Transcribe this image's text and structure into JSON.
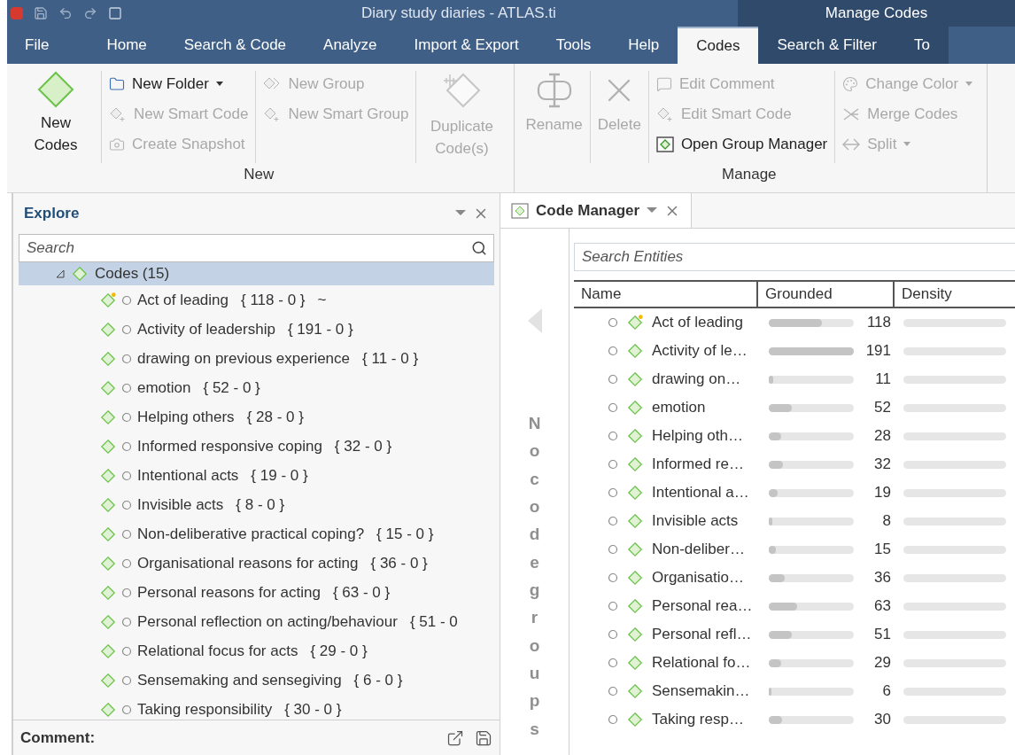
{
  "window": {
    "title": "Diary study diaries - ATLAS.ti",
    "context_title": "Manage Codes"
  },
  "tabs": [
    {
      "label": "File",
      "selected": false
    },
    {
      "label": "Home",
      "selected": false
    },
    {
      "label": "Search & Code",
      "selected": false
    },
    {
      "label": "Analyze",
      "selected": false
    },
    {
      "label": "Import & Export",
      "selected": false
    },
    {
      "label": "Tools",
      "selected": false
    },
    {
      "label": "Help",
      "selected": false
    },
    {
      "label": "Codes",
      "selected": true
    },
    {
      "label": "Search & Filter",
      "selected": false
    },
    {
      "label": "To",
      "selected": false
    }
  ],
  "ribbon": {
    "groups": [
      {
        "label": "New",
        "columns": [
          {
            "kind": "large",
            "items": [
              {
                "label": "New Codes",
                "kind": "diamond",
                "disabled": false
              }
            ]
          },
          {
            "kind": "small",
            "items": [
              {
                "label": "New Folder",
                "kind": "folder",
                "disabled": false,
                "dropdown": true
              },
              {
                "label": "New Smart Code",
                "kind": "smart",
                "disabled": true,
                "dropdown": false
              },
              {
                "label": "Create Snapshot",
                "kind": "camera",
                "disabled": true,
                "dropdown": false
              }
            ]
          },
          {
            "kind": "small",
            "items": [
              {
                "label": "New Group",
                "kind": "group",
                "disabled": true,
                "dropdown": false
              },
              {
                "label": "New Smart Group",
                "kind": "smart",
                "disabled": true,
                "dropdown": false
              }
            ]
          },
          {
            "kind": "large",
            "items": [
              {
                "label": "Duplicate Code(s)",
                "kind": "duplicate",
                "disabled": true
              }
            ]
          }
        ]
      },
      {
        "label": "Manage",
        "columns": [
          {
            "kind": "large",
            "items": [
              {
                "label": "Rename",
                "kind": "rename",
                "disabled": true
              }
            ]
          },
          {
            "kind": "large",
            "items": [
              {
                "label": "Delete",
                "kind": "delete",
                "disabled": true
              }
            ]
          },
          {
            "kind": "small",
            "items": [
              {
                "label": "Edit Comment",
                "kind": "comment",
                "disabled": true,
                "dropdown": false
              },
              {
                "label": "Edit Smart Code",
                "kind": "smart",
                "disabled": true,
                "dropdown": false
              },
              {
                "label": "Open Group Manager",
                "kind": "manager",
                "disabled": false,
                "dropdown": false
              }
            ]
          },
          {
            "kind": "small",
            "items": [
              {
                "label": "Change Color",
                "kind": "palette",
                "disabled": true,
                "dropdown": true
              },
              {
                "label": "Merge Codes",
                "kind": "merge",
                "disabled": true,
                "dropdown": false
              },
              {
                "label": "Split",
                "kind": "split",
                "disabled": true,
                "dropdown": true
              }
            ]
          }
        ]
      }
    ]
  },
  "explore": {
    "title": "Explore",
    "search": {
      "placeholder": "Search"
    },
    "tree": {
      "label": "Codes (15)",
      "expanded": true,
      "selected": true,
      "children": [
        {
          "label": "Act of leading",
          "counts": "{ 118 - 0 }",
          "suffix": "~",
          "has_comment": true
        },
        {
          "label": "Activity of leadership",
          "counts": "{ 191 - 0 }",
          "has_comment": false
        },
        {
          "label": "drawing on previous experience",
          "counts": "{ 11 - 0 }",
          "has_comment": false
        },
        {
          "label": "emotion",
          "counts": "{ 52 - 0 }",
          "has_comment": false
        },
        {
          "label": "Helping others",
          "counts": "{ 28 - 0 }",
          "has_comment": false
        },
        {
          "label": "Informed responsive coping",
          "counts": "{ 32 - 0 }",
          "has_comment": false
        },
        {
          "label": "Intentional acts",
          "counts": "{ 19 - 0 }",
          "has_comment": false
        },
        {
          "label": "Invisible acts",
          "counts": "{ 8 - 0 }",
          "has_comment": false
        },
        {
          "label": "Non-deliberative practical coping?",
          "counts": "{ 15 - 0 }",
          "has_comment": false
        },
        {
          "label": "Organisational reasons for acting",
          "counts": "{ 36 - 0 }",
          "has_comment": false
        },
        {
          "label": "Personal reasons for acting",
          "counts": "{ 63 - 0 }",
          "has_comment": false
        },
        {
          "label": "Personal reflection on acting/behaviour",
          "counts": "{ 51 - 0",
          "has_comment": false
        },
        {
          "label": "Relational focus for acts",
          "counts": "{ 29 - 0 }",
          "has_comment": false
        },
        {
          "label": "Sensemaking and sensegiving",
          "counts": "{ 6 - 0 }",
          "has_comment": false
        },
        {
          "label": "Taking responsibility",
          "counts": "{ 30 - 0 }",
          "has_comment": false
        }
      ]
    },
    "comment_label": "Comment:"
  },
  "code_manager": {
    "title": "Code Manager",
    "groups_placeholder": "No code groups",
    "search": {
      "placeholder": "Search Entities"
    },
    "columns": [
      "Name",
      "Grounded",
      "Density"
    ],
    "rows": [
      {
        "name": "Act of leading",
        "has_comment": true,
        "grounded": "118",
        "level": 0.62
      },
      {
        "name": "Activity of le…",
        "has_comment": false,
        "grounded": "191",
        "level": 1
      },
      {
        "name": "drawing on…",
        "has_comment": false,
        "grounded": "11",
        "level": 0.05
      },
      {
        "name": "emotion",
        "has_comment": false,
        "grounded": "52",
        "level": 0.27
      },
      {
        "name": "Helping oth…",
        "has_comment": false,
        "grounded": "28",
        "level": 0.15
      },
      {
        "name": "Informed re…",
        "has_comment": false,
        "grounded": "32",
        "level": 0.17
      },
      {
        "name": "Intentional a…",
        "has_comment": false,
        "grounded": "19",
        "level": 0.1
      },
      {
        "name": "Invisible acts",
        "has_comment": false,
        "grounded": "8",
        "level": 0.04
      },
      {
        "name": "Non-deliber…",
        "has_comment": false,
        "grounded": "15",
        "level": 0.08
      },
      {
        "name": "Organisatio…",
        "has_comment": false,
        "grounded": "36",
        "level": 0.19
      },
      {
        "name": "Personal rea…",
        "has_comment": false,
        "grounded": "63",
        "level": 0.33
      },
      {
        "name": "Personal refl…",
        "has_comment": false,
        "grounded": "51",
        "level": 0.27
      },
      {
        "name": "Relational fo…",
        "has_comment": false,
        "grounded": "29",
        "level": 0.15
      },
      {
        "name": "Sensemakin…",
        "has_comment": false,
        "grounded": "6",
        "level": 0.03
      },
      {
        "name": "Taking resp…",
        "has_comment": false,
        "grounded": "30",
        "level": 0.16
      }
    ]
  }
}
